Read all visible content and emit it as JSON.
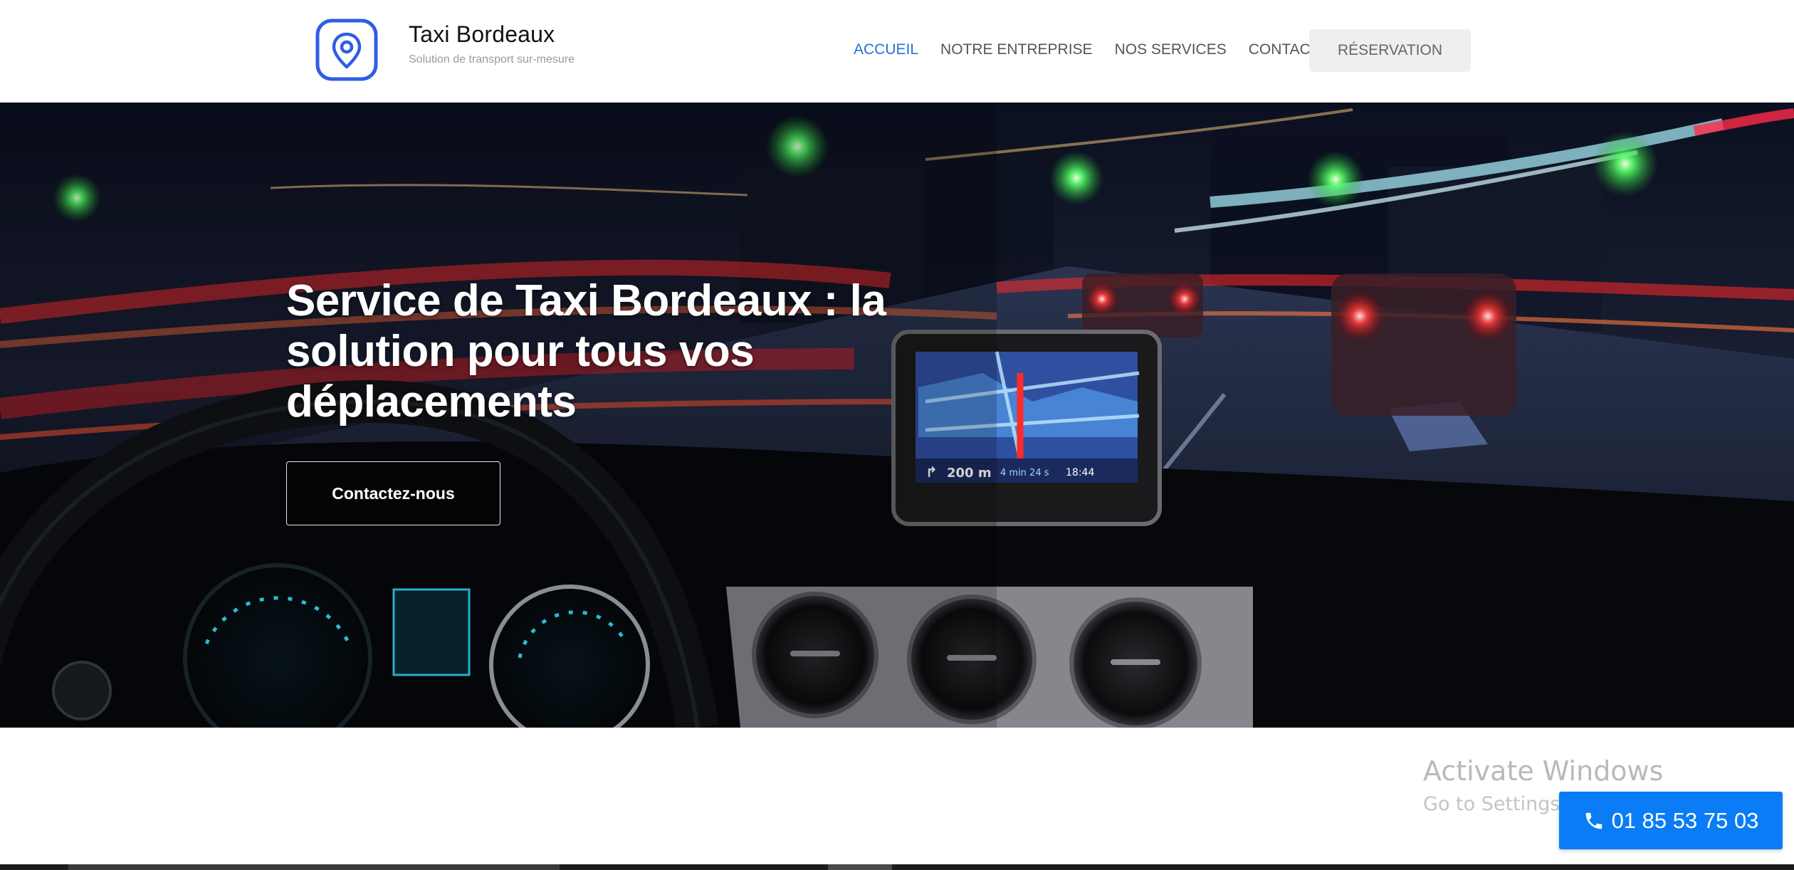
{
  "brand": {
    "name": "Taxi Bordeaux",
    "tagline": "Solution de transport sur-mesure",
    "logo_icon": "map-pin-icon",
    "accent_color": "#2f5fe0"
  },
  "nav": {
    "items": [
      {
        "label": "ACCUEIL",
        "active": true
      },
      {
        "label": "NOTRE ENTREPRISE",
        "active": false
      },
      {
        "label": "NOS SERVICES",
        "active": false
      },
      {
        "label": "CONTACT",
        "active": false
      }
    ],
    "reservation_label": "RÉSERVATION",
    "active_color": "#1f74d6"
  },
  "hero": {
    "title": "Service de Taxi Bordeaux : la solution pour tous vos déplacements",
    "cta_label": "Contactez-nous",
    "gps": {
      "distance": "200 m",
      "duration": "4 min 24 s",
      "time": "18:44"
    }
  },
  "windows_watermark": {
    "title": "Activate Windows",
    "subtitle": "Go to Settings to activate Windows."
  },
  "phone_button": {
    "number": "01 85 53 75 03",
    "icon": "phone-icon",
    "color": "#0a7cf5"
  }
}
